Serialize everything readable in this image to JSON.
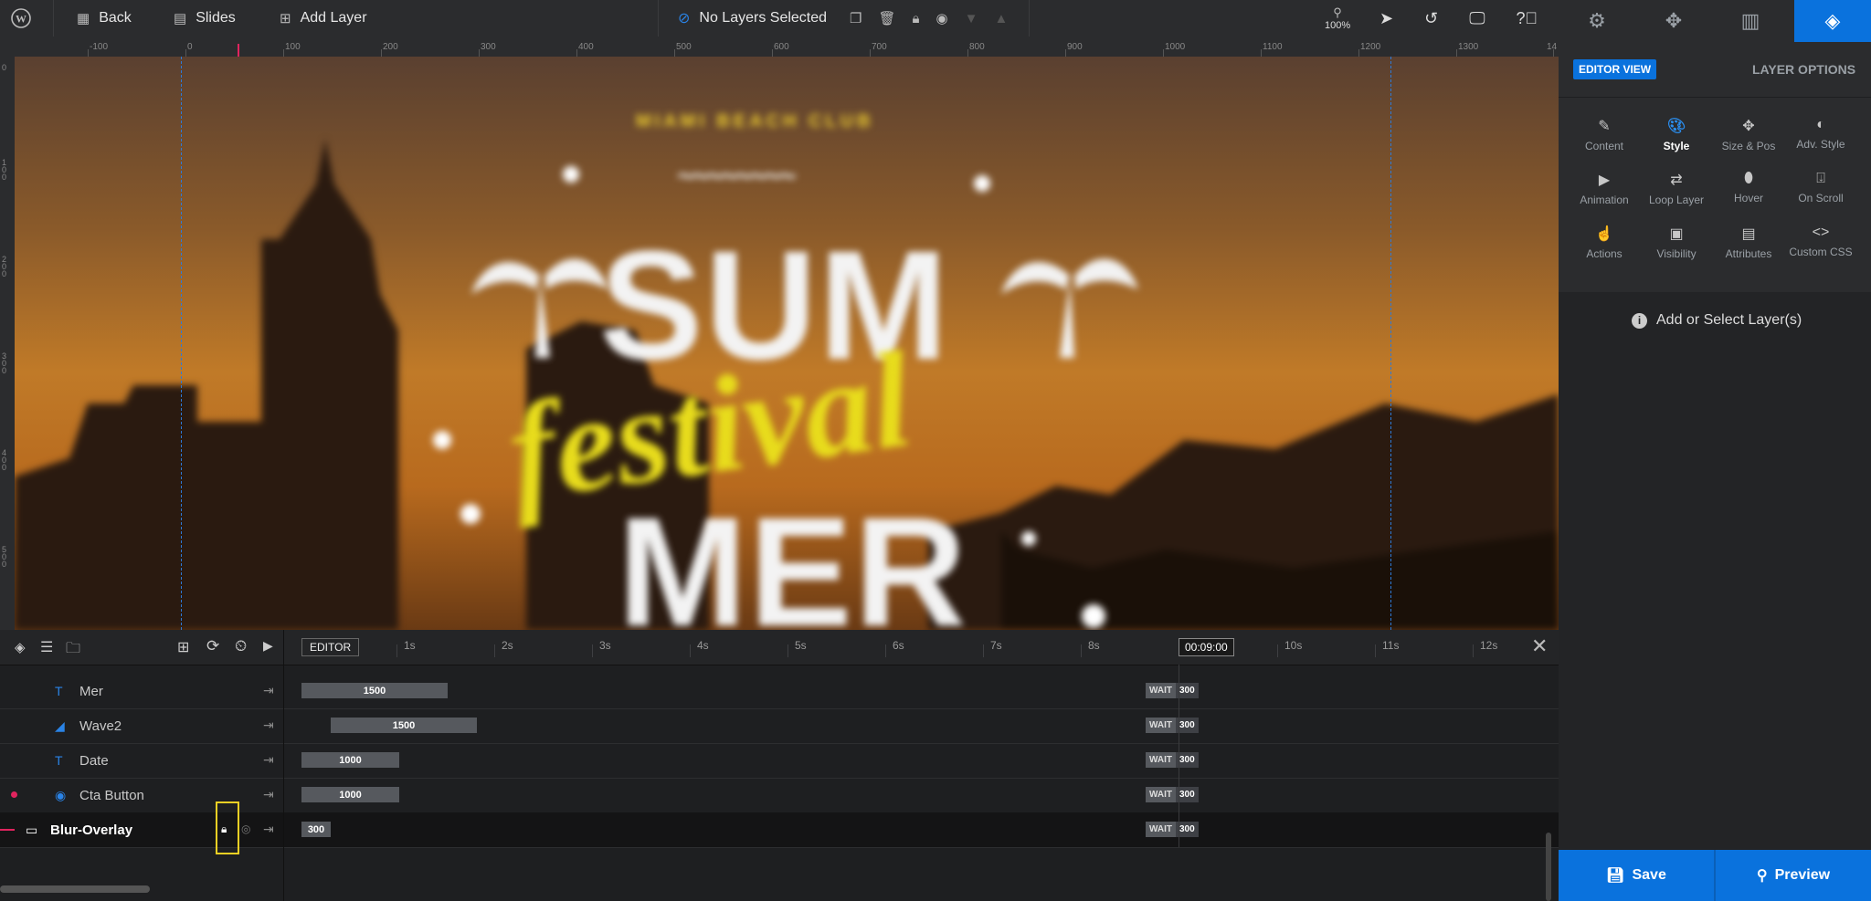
{
  "topbar": {
    "back_label": "Back",
    "slides_label": "Slides",
    "add_layer_label": "Add Layer",
    "selection_status": "No Layers Selected",
    "zoom": "100%"
  },
  "ruler": {
    "labels": [
      "-100",
      "0",
      "100",
      "200",
      "300",
      "400",
      "500",
      "600",
      "700",
      "800",
      "900",
      "1000",
      "1100",
      "1200",
      "1300",
      "14"
    ]
  },
  "canvas": {
    "club_text": "MIAMI BEACH CLUB",
    "wave_text": "~~~~~~~~",
    "headline_top": "SUM",
    "headline_script": "festival",
    "headline_bottom": "MER"
  },
  "timeline": {
    "editor_label": "EDITOR",
    "time_labels": [
      "1s",
      "2s",
      "3s",
      "4s",
      "5s",
      "6s",
      "7s",
      "8s",
      "10s",
      "11s",
      "12s"
    ],
    "current_time": "00:09:00",
    "wait_label": "WAIT",
    "layers": [
      {
        "name": "Mer",
        "icon": "text-icon",
        "duration": "1500",
        "wait": "300"
      },
      {
        "name": "Wave2",
        "icon": "shape-icon",
        "duration": "1500",
        "wait": "300"
      },
      {
        "name": "Date",
        "icon": "text-icon",
        "duration": "1000",
        "wait": "300"
      },
      {
        "name": "Cta Button",
        "icon": "button-icon",
        "duration": "1000",
        "wait": "300"
      },
      {
        "name": "Blur-Overlay",
        "icon": "container-icon",
        "duration": "300",
        "wait": "300"
      }
    ]
  },
  "panel": {
    "editor_view_label": "EDITOR VIEW",
    "layer_options_label": "LAYER OPTIONS",
    "options": [
      "Content",
      "Style",
      "Size & Pos",
      "Adv. Style",
      "Animation",
      "Loop Layer",
      "Hover",
      "On Scroll",
      "Actions",
      "Visibility",
      "Attributes",
      "Custom CSS"
    ],
    "empty_message": "Add or Select Layer(s)",
    "save_label": "Save",
    "preview_label": "Preview"
  },
  "colors": {
    "accent": "#0a72dd",
    "highlight": "#f2d024",
    "script_text": "#e8dc1c"
  }
}
